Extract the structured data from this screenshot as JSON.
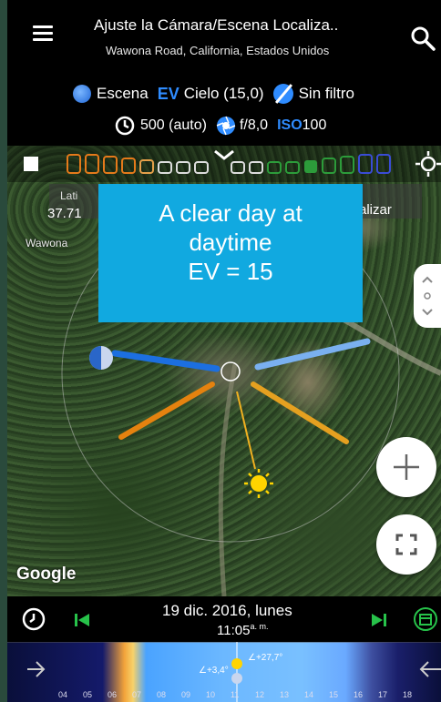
{
  "header": {
    "title": "Ajuste la Cámara/Escena Localiza..",
    "subtitle": "Wawona Road, California, Estados Unidos",
    "scene_label": "Escena",
    "ev_label": "EV",
    "sky_label": "Cielo (15,0)",
    "filter_label": "Sin filtro",
    "shutter_label": "500 (auto)",
    "aperture_label": "f/8,0",
    "iso_label": "ISO",
    "iso_value": "100"
  },
  "map": {
    "latitude_label": "Lati",
    "latitude_value": "37.71",
    "locate_label": "alizar",
    "road_label": "Wawona",
    "google_logo": "Google",
    "callout": {
      "line1": "A clear day at",
      "line2": "daytime",
      "line3": "EV = 15"
    }
  },
  "footer": {
    "date": "19 dic. 2016, lunes",
    "time": "11:05",
    "time_suffix": "a. m.",
    "sun_alt_left": "∠+3,4°",
    "sun_alt_right": "∠+27,7°",
    "hours": [
      "04",
      "05",
      "06",
      "07",
      "08",
      "09",
      "10",
      "11",
      "12",
      "13",
      "14",
      "15",
      "16",
      "17",
      "18"
    ]
  },
  "colors": {
    "accent": "#2f8cff",
    "callout": "#11a9e0",
    "sunrise_line": "#e5820f",
    "moon_line": "#1c6fe0"
  }
}
